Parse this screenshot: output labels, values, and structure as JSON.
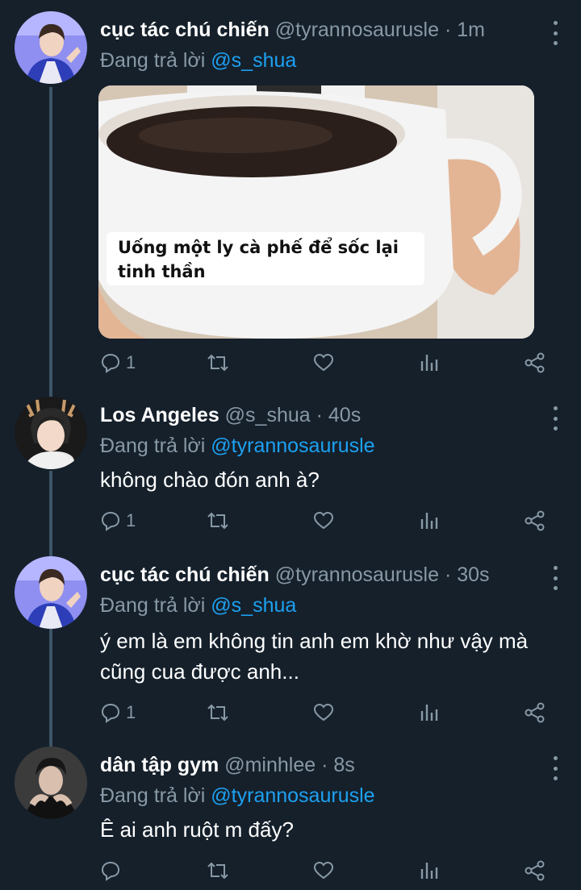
{
  "tweets": [
    {
      "name": "cục tác chú chiến",
      "handle": "@tyrannosaurusle · 1m",
      "replying_prefix": "Đang trả lời",
      "replying_to": "@s_shua",
      "text": "",
      "image_caption_line1": "Uống một ly cà phế để sốc lại",
      "image_caption_line2": "tinh thần",
      "reply_count": "1"
    },
    {
      "name": "Los Angeles",
      "handle": "@s_shua · 40s",
      "replying_prefix": "Đang trả lời",
      "replying_to": "@tyrannosaurusle",
      "text": "không chào đón anh à?",
      "reply_count": "1"
    },
    {
      "name": "cục tác chú chiến",
      "handle": "@tyrannosaurusle · 30s",
      "replying_prefix": "Đang trả lời",
      "replying_to": "@s_shua",
      "text_line1": "ý em là em không tin anh em khờ như vậy mà",
      "text_line2": "cũng cua được anh...",
      "reply_count": "1"
    },
    {
      "name": "dân tập gym",
      "handle": "@minhlee · 8s",
      "replying_prefix": "Đang trả lời",
      "replying_to": "@tyrannosaurusle",
      "text": "Ê ai anh ruột m đấy?",
      "reply_count": ""
    }
  ],
  "icons": [
    "reply-icon",
    "retweet-icon",
    "like-icon",
    "analytics-icon",
    "share-icon",
    "more-icon"
  ],
  "colors": {
    "background": "#15202b",
    "secondary": "#8899a6",
    "accent": "#1da1f2",
    "thread": "#3d5466"
  }
}
